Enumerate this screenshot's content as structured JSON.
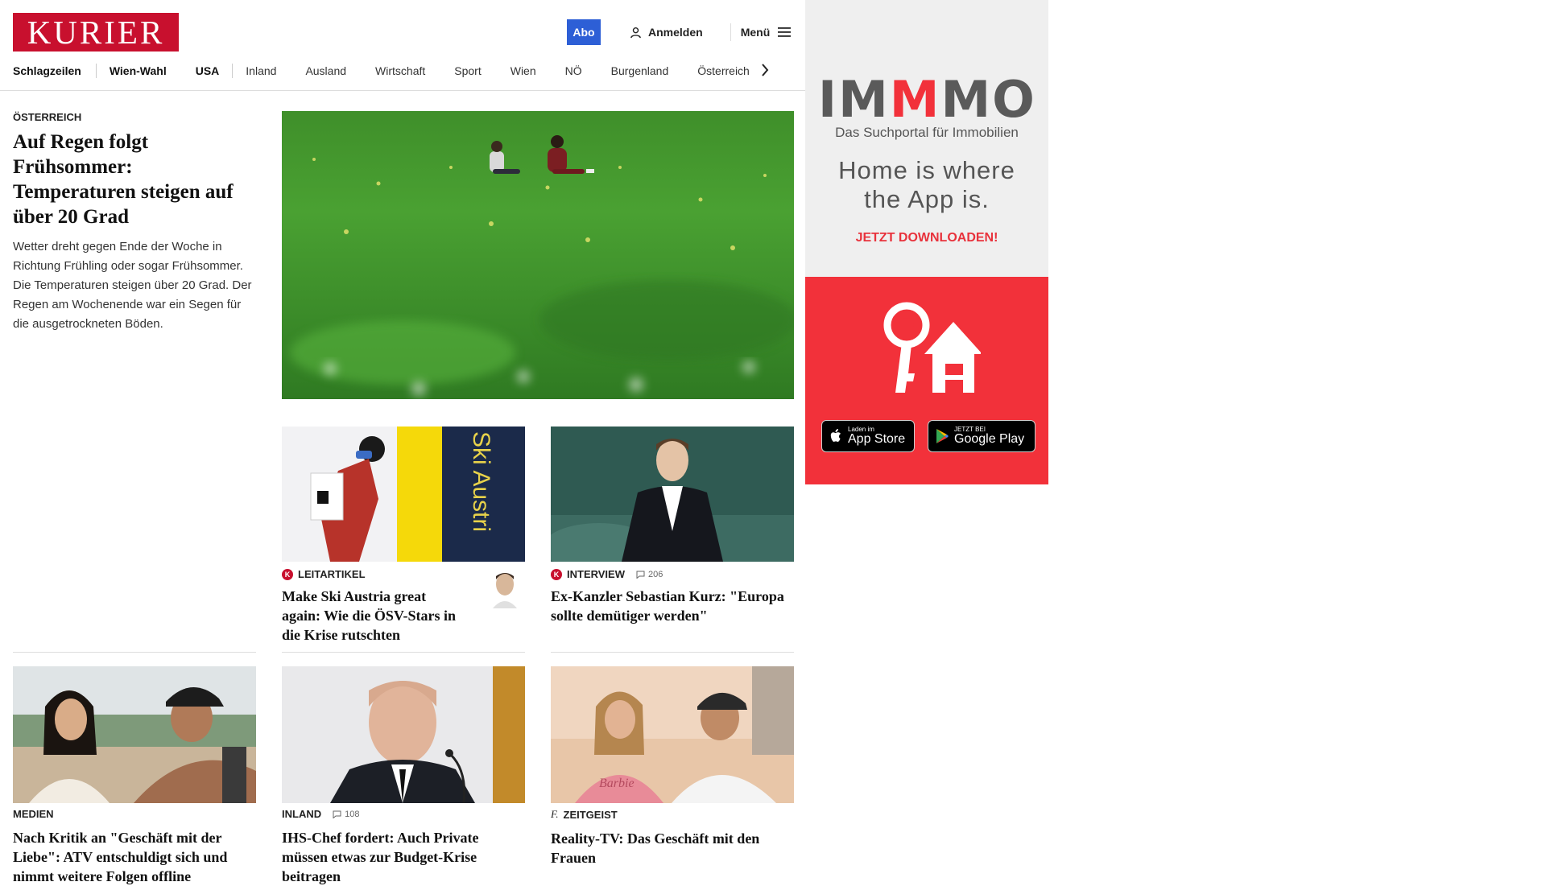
{
  "header": {
    "logo": "KURIER",
    "abo": "Abo",
    "login": "Anmelden",
    "menu": "Menü"
  },
  "nav": {
    "items": [
      "Schlagzeilen",
      "Wien-Wahl",
      "USA",
      "Inland",
      "Ausland",
      "Wirtschaft",
      "Sport",
      "Wien",
      "NÖ",
      "Burgenland",
      "Österreich"
    ]
  },
  "lead": {
    "kicker": "ÖSTERREICH",
    "headline": "Auf Regen folgt Frühsommer: Temperaturen steigen auf über 20 Grad",
    "teaser": "Wetter dreht gegen Ende der Woche in Richtung Frühling oder sogar Frühsommer. Die Temperaturen steigen über 20 Grad. Der Regen am Wochenende war ein Segen für die ausgetrockneten Böden."
  },
  "articles": [
    {
      "kicker": "LEITARTIKEL",
      "headline": "Make Ski Austria great again: Wie die ÖSV-Stars in die Krise rutschten"
    },
    {
      "kicker": "INTERVIEW",
      "comments": "206",
      "headline": "Ex-Kanzler Sebastian Kurz: \"Europa sollte demütiger werden\""
    },
    {
      "kicker": "MEDIEN",
      "headline": "Nach Kritik an \"Geschäft mit der Liebe\": ATV entschuldigt sich und nimmt weitere Folgen offline"
    },
    {
      "kicker": "INLAND",
      "comments": "108",
      "headline": "IHS-Chef fordert: Auch Private müssen etwas zur Budget-Krise beitragen"
    },
    {
      "kicker": "ZEITGEIST",
      "headline": "Reality-TV: Das Geschäft mit den Frauen"
    }
  ],
  "images": {
    "ski_banner_text": "Ski Austri",
    "shirt_text": "Barbie"
  },
  "ad": {
    "brand": "IMMMO",
    "tagline": "Das Suchportal für Immobilien",
    "claim": "Home is where the App is.",
    "cta": "JETZT DOWNLOADEN!",
    "appstore_small": "Laden im",
    "appstore_big": "App Store",
    "googleplay_small": "JETZT BEI",
    "googleplay_big": "Google Play"
  },
  "colors": {
    "brand_red": "#c8102e",
    "abo_blue": "#2d5fd6",
    "ad_red": "#f2313a",
    "ad_gray": "#5a5a5a"
  }
}
